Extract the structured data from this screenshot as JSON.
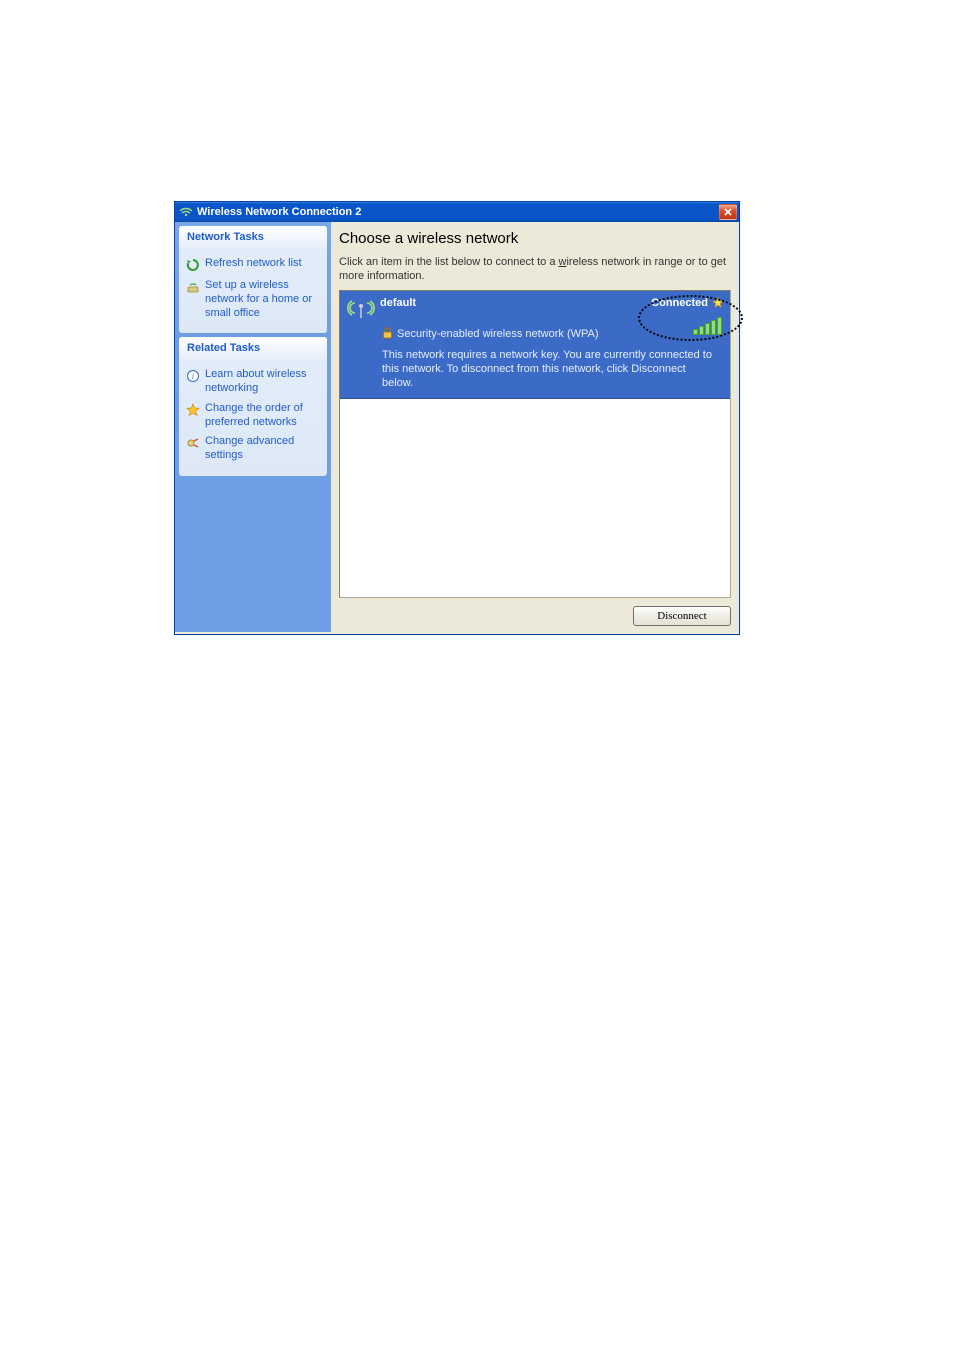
{
  "window": {
    "title": "Wireless Network Connection 2"
  },
  "sidebar": {
    "panels": [
      {
        "header": "Network Tasks",
        "items": [
          {
            "label": "Refresh network list"
          },
          {
            "label": "Set up a wireless network for a home or small office"
          }
        ]
      },
      {
        "header": "Related Tasks",
        "items": [
          {
            "label": "Learn about wireless networking"
          },
          {
            "label": "Change the order of preferred networks"
          },
          {
            "label": "Change advanced settings"
          }
        ]
      }
    ]
  },
  "main": {
    "heading": "Choose a wireless network",
    "instruction_pre": "Click an item in the list below to connect to a ",
    "instruction_uword": "w",
    "instruction_post": "ireless network in range or to get more information.",
    "network": {
      "name": "default",
      "status": "Connected",
      "security_line": "Security-enabled wireless network (WPA)",
      "description": "This network requires a network key. You are currently connected to this network. To disconnect from this network, click Disconnect below."
    },
    "button": "Disconnect"
  }
}
